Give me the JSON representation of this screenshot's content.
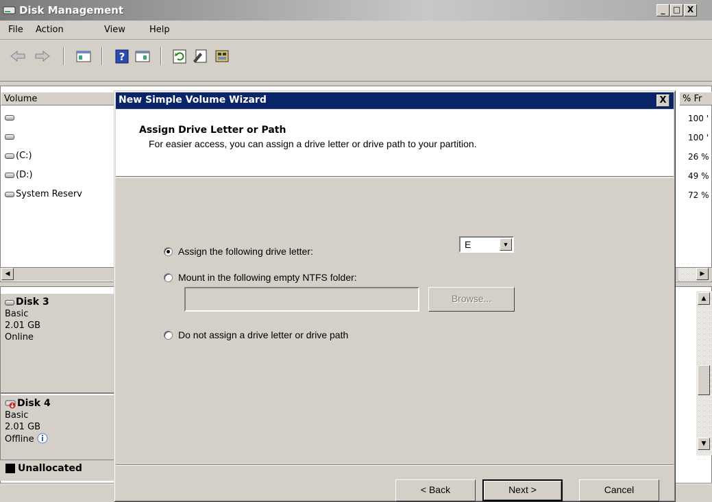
{
  "window": {
    "title": "Disk Management",
    "minimize": "_",
    "maximize": "□",
    "close": "X"
  },
  "menu": [
    "File",
    "Action",
    "View",
    "Help"
  ],
  "toolbar_icons": [
    "back-arrow-icon",
    "forward-arrow-icon",
    "console-tree-icon",
    "help-icon",
    "properties-pane-icon",
    "refresh-icon",
    "properties-icon",
    "disk-settings-icon"
  ],
  "volume_list": {
    "column_volume": "Volume",
    "column_pct_free": "% Fr",
    "rows": [
      {
        "name": ""
      },
      {
        "name": ""
      },
      {
        "name": "(C:)"
      },
      {
        "name": "(D:)"
      },
      {
        "name": "System Reserv"
      }
    ],
    "pct_free": [
      "100 '",
      "100 '",
      "26 %",
      "49 %",
      "72 %"
    ]
  },
  "disks": [
    {
      "name": "Disk 3",
      "type": "Basic",
      "size": "2.01 GB",
      "status": "Online"
    },
    {
      "name": "Disk 4",
      "type": "Basic",
      "size": "2.01 GB",
      "status": "Offline"
    }
  ],
  "legend": {
    "label": "Unallocated",
    "color": "#000000"
  },
  "wizard": {
    "title": "New Simple Volume Wizard",
    "close": "X",
    "heading": "Assign Drive Letter or Path",
    "subheading": "For easier access, you can assign a drive letter or drive path to your partition.",
    "option_assign": "Assign the following drive letter:",
    "option_mount": "Mount in the following empty NTFS folder:",
    "option_none": "Do not assign a drive letter or drive path",
    "selected_option": "assign",
    "drive_letter": "E",
    "folder_path": "",
    "browse": "Browse...",
    "back": "< Back",
    "next": "Next >",
    "cancel": "Cancel"
  }
}
